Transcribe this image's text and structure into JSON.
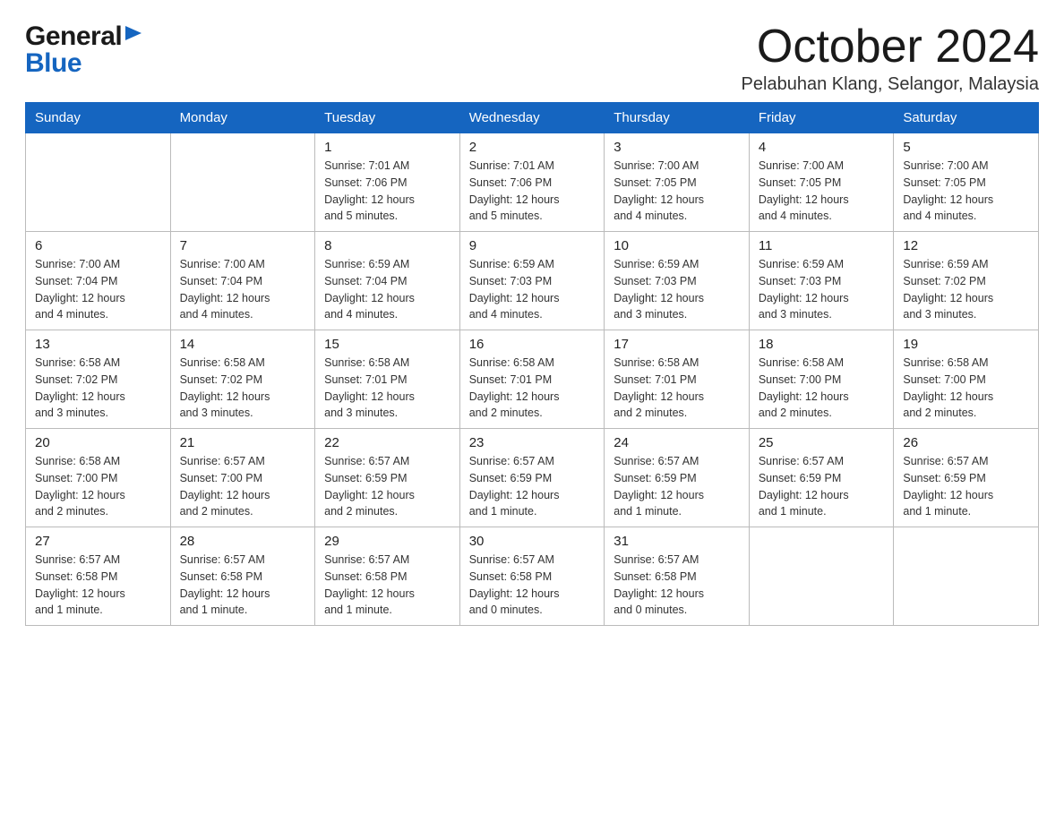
{
  "header": {
    "logo_general": "General",
    "logo_blue": "Blue",
    "month_title": "October 2024",
    "location": "Pelabuhan Klang, Selangor, Malaysia"
  },
  "days_of_week": [
    "Sunday",
    "Monday",
    "Tuesday",
    "Wednesday",
    "Thursday",
    "Friday",
    "Saturday"
  ],
  "weeks": [
    [
      {
        "day": "",
        "info": ""
      },
      {
        "day": "",
        "info": ""
      },
      {
        "day": "1",
        "info": "Sunrise: 7:01 AM\nSunset: 7:06 PM\nDaylight: 12 hours\nand 5 minutes."
      },
      {
        "day": "2",
        "info": "Sunrise: 7:01 AM\nSunset: 7:06 PM\nDaylight: 12 hours\nand 5 minutes."
      },
      {
        "day": "3",
        "info": "Sunrise: 7:00 AM\nSunset: 7:05 PM\nDaylight: 12 hours\nand 4 minutes."
      },
      {
        "day": "4",
        "info": "Sunrise: 7:00 AM\nSunset: 7:05 PM\nDaylight: 12 hours\nand 4 minutes."
      },
      {
        "day": "5",
        "info": "Sunrise: 7:00 AM\nSunset: 7:05 PM\nDaylight: 12 hours\nand 4 minutes."
      }
    ],
    [
      {
        "day": "6",
        "info": "Sunrise: 7:00 AM\nSunset: 7:04 PM\nDaylight: 12 hours\nand 4 minutes."
      },
      {
        "day": "7",
        "info": "Sunrise: 7:00 AM\nSunset: 7:04 PM\nDaylight: 12 hours\nand 4 minutes."
      },
      {
        "day": "8",
        "info": "Sunrise: 6:59 AM\nSunset: 7:04 PM\nDaylight: 12 hours\nand 4 minutes."
      },
      {
        "day": "9",
        "info": "Sunrise: 6:59 AM\nSunset: 7:03 PM\nDaylight: 12 hours\nand 4 minutes."
      },
      {
        "day": "10",
        "info": "Sunrise: 6:59 AM\nSunset: 7:03 PM\nDaylight: 12 hours\nand 3 minutes."
      },
      {
        "day": "11",
        "info": "Sunrise: 6:59 AM\nSunset: 7:03 PM\nDaylight: 12 hours\nand 3 minutes."
      },
      {
        "day": "12",
        "info": "Sunrise: 6:59 AM\nSunset: 7:02 PM\nDaylight: 12 hours\nand 3 minutes."
      }
    ],
    [
      {
        "day": "13",
        "info": "Sunrise: 6:58 AM\nSunset: 7:02 PM\nDaylight: 12 hours\nand 3 minutes."
      },
      {
        "day": "14",
        "info": "Sunrise: 6:58 AM\nSunset: 7:02 PM\nDaylight: 12 hours\nand 3 minutes."
      },
      {
        "day": "15",
        "info": "Sunrise: 6:58 AM\nSunset: 7:01 PM\nDaylight: 12 hours\nand 3 minutes."
      },
      {
        "day": "16",
        "info": "Sunrise: 6:58 AM\nSunset: 7:01 PM\nDaylight: 12 hours\nand 2 minutes."
      },
      {
        "day": "17",
        "info": "Sunrise: 6:58 AM\nSunset: 7:01 PM\nDaylight: 12 hours\nand 2 minutes."
      },
      {
        "day": "18",
        "info": "Sunrise: 6:58 AM\nSunset: 7:00 PM\nDaylight: 12 hours\nand 2 minutes."
      },
      {
        "day": "19",
        "info": "Sunrise: 6:58 AM\nSunset: 7:00 PM\nDaylight: 12 hours\nand 2 minutes."
      }
    ],
    [
      {
        "day": "20",
        "info": "Sunrise: 6:58 AM\nSunset: 7:00 PM\nDaylight: 12 hours\nand 2 minutes."
      },
      {
        "day": "21",
        "info": "Sunrise: 6:57 AM\nSunset: 7:00 PM\nDaylight: 12 hours\nand 2 minutes."
      },
      {
        "day": "22",
        "info": "Sunrise: 6:57 AM\nSunset: 6:59 PM\nDaylight: 12 hours\nand 2 minutes."
      },
      {
        "day": "23",
        "info": "Sunrise: 6:57 AM\nSunset: 6:59 PM\nDaylight: 12 hours\nand 1 minute."
      },
      {
        "day": "24",
        "info": "Sunrise: 6:57 AM\nSunset: 6:59 PM\nDaylight: 12 hours\nand 1 minute."
      },
      {
        "day": "25",
        "info": "Sunrise: 6:57 AM\nSunset: 6:59 PM\nDaylight: 12 hours\nand 1 minute."
      },
      {
        "day": "26",
        "info": "Sunrise: 6:57 AM\nSunset: 6:59 PM\nDaylight: 12 hours\nand 1 minute."
      }
    ],
    [
      {
        "day": "27",
        "info": "Sunrise: 6:57 AM\nSunset: 6:58 PM\nDaylight: 12 hours\nand 1 minute."
      },
      {
        "day": "28",
        "info": "Sunrise: 6:57 AM\nSunset: 6:58 PM\nDaylight: 12 hours\nand 1 minute."
      },
      {
        "day": "29",
        "info": "Sunrise: 6:57 AM\nSunset: 6:58 PM\nDaylight: 12 hours\nand 1 minute."
      },
      {
        "day": "30",
        "info": "Sunrise: 6:57 AM\nSunset: 6:58 PM\nDaylight: 12 hours\nand 0 minutes."
      },
      {
        "day": "31",
        "info": "Sunrise: 6:57 AM\nSunset: 6:58 PM\nDaylight: 12 hours\nand 0 minutes."
      },
      {
        "day": "",
        "info": ""
      },
      {
        "day": "",
        "info": ""
      }
    ]
  ]
}
